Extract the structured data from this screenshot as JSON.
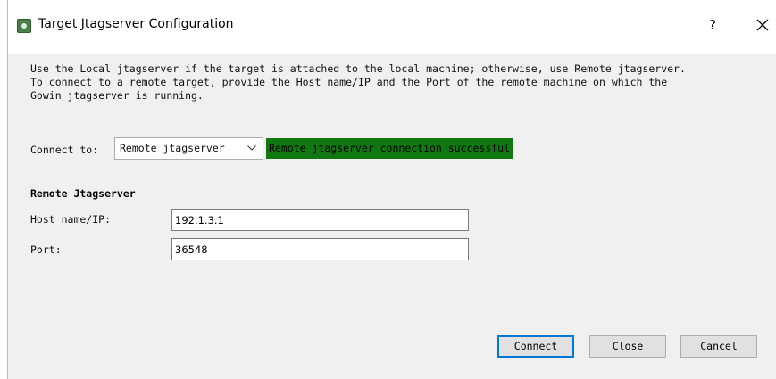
{
  "window": {
    "title": "Target Jtagserver Configuration",
    "help_label": "?"
  },
  "description": "Use the Local jtagserver if the target is attached to the local machine; otherwise, use Remote jtagserver.\nTo connect to a remote target, provide the Host name/IP and the Port of the remote machine on which the\nGowin jtagserver is running.",
  "connect": {
    "label": "Connect to:",
    "selected": "Remote jtagserver",
    "status": "Remote jtagserver connection successful"
  },
  "remote": {
    "section_title": "Remote Jtagserver",
    "host_label": "Host name/IP:",
    "host_value": "192.1.3.1",
    "port_label": "Port:",
    "port_value": "36548"
  },
  "buttons": {
    "connect": "Connect",
    "close": "Close",
    "cancel": "Cancel"
  },
  "colors": {
    "status_bg": "#117711",
    "default_button_border": "#0078d7"
  },
  "icons": {
    "app": "app-icon",
    "close": "close-icon",
    "dropdown": "chevron-down-icon"
  }
}
